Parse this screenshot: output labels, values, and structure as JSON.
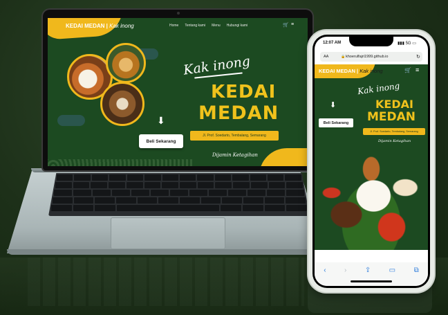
{
  "laptop_site": {
    "brand": "KEDAI MEDAN",
    "brand_sub": "Kak inong",
    "nav": [
      "Home",
      "Tentang kami",
      "Menu",
      "Hubungi kami"
    ],
    "cart_icon": "cart-icon",
    "menu_icon": "hamburger-icon",
    "script_title": "Kak inong",
    "title_line1": "KEDAI",
    "title_line2": "MEDAN",
    "address": "Jl. Prof. Soedarto, Tembalang, Semarang",
    "cta": "Beli Sekarang",
    "tagline": "Dijamin Ketagihan",
    "accent": "#f0b81c",
    "bg": "#1c4a21"
  },
  "phone": {
    "time": "12:07 AM",
    "network": "5G",
    "url_aa": "AA",
    "url": "khoerulfajri1999.github.io",
    "site": {
      "brand": "KEDAI MEDAN",
      "brand_sub": "Kak inong",
      "script_title": "Kak inong",
      "title_line1": "KEDAI",
      "title_line2": "MEDAN",
      "cta": "Beli Sekarang",
      "address": "Jl. Prof. Soedarto, Tembalang, Semarang",
      "tagline": "Dijamin Ketagihan"
    }
  }
}
